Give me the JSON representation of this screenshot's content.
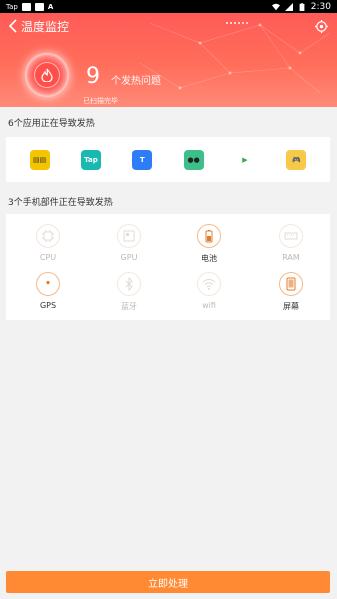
{
  "status_bar": {
    "carrier": "Tap",
    "icon3": "A",
    "time": "2:30"
  },
  "header": {
    "title": "温度监控",
    "count": "9",
    "count_label": "个发热问题",
    "sub_label": "已扫描完毕"
  },
  "apps_section": {
    "title": "6个应用正在导致发热",
    "apps": [
      {
        "name": "app1-icon",
        "glyph": "▤▤",
        "color": "#f5c400",
        "fg": "#333"
      },
      {
        "name": "tap-icon",
        "glyph": "Tap",
        "color": "#19b8b0",
        "fg": "#fff"
      },
      {
        "name": "t-app-icon",
        "glyph": "T",
        "color": "#2d7df6",
        "fg": "#fff"
      },
      {
        "name": "panda-app-icon",
        "glyph": "●●",
        "color": "#3dbf8a",
        "fg": "#222"
      },
      {
        "name": "play-store-icon",
        "glyph": "▶",
        "color": "#ffffff",
        "fg": "#34a853"
      },
      {
        "name": "game-app-icon",
        "glyph": "🎮",
        "color": "#f7c948",
        "fg": "#333"
      }
    ]
  },
  "parts_section": {
    "title": "3个手机部件正在导致发热",
    "parts": [
      {
        "label": "CPU",
        "active": false,
        "icon": "cpu-icon"
      },
      {
        "label": "GPU",
        "active": false,
        "icon": "gpu-icon"
      },
      {
        "label": "电池",
        "active": true,
        "icon": "battery-icon"
      },
      {
        "label": "RAM",
        "active": false,
        "icon": "ram-icon"
      },
      {
        "label": "GPS",
        "active": true,
        "icon": "gps-icon"
      },
      {
        "label": "蓝牙",
        "active": false,
        "icon": "bluetooth-icon"
      },
      {
        "label": "wifi",
        "active": false,
        "icon": "wifi-icon"
      },
      {
        "label": "屏幕",
        "active": true,
        "icon": "screen-icon"
      }
    ]
  },
  "action_button": {
    "label": "立即处理"
  }
}
